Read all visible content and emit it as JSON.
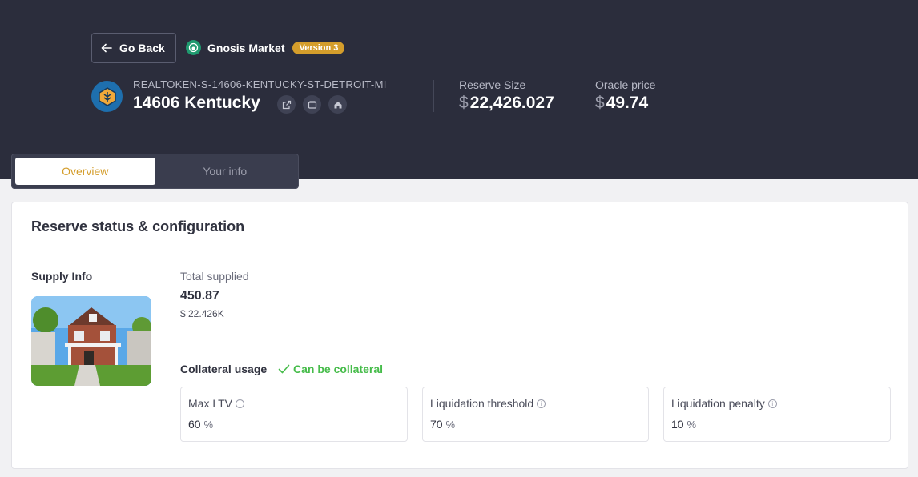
{
  "header": {
    "go_back_label": "Go Back",
    "market_name": "Gnosis Market",
    "market_version": "Version 3"
  },
  "asset": {
    "symbol": "REALTOKEN-S-14606-KENTUCKY-ST-DETROIT-MI",
    "name": "14606 Kentucky",
    "actions": [
      "external-link-icon",
      "wallet-icon",
      "home-icon"
    ]
  },
  "stats": {
    "reserve_size_label": "Reserve Size",
    "reserve_size_currency": "$",
    "reserve_size_value": "22,426.027",
    "oracle_price_label": "Oracle price",
    "oracle_price_currency": "$",
    "oracle_price_value": "49.74"
  },
  "tabs": [
    {
      "label": "Overview",
      "active": true
    },
    {
      "label": "Your info",
      "active": false
    }
  ],
  "reserve": {
    "title": "Reserve status & configuration",
    "supply_info_label": "Supply Info",
    "total_supplied_label": "Total supplied",
    "total_supplied_value": "450.87",
    "total_supplied_usd": "$ 22.426K",
    "collateral_usage_label": "Collateral usage",
    "collateral_status": "Can be collateral",
    "metrics": [
      {
        "label": "Max LTV",
        "value": "60",
        "unit": "%"
      },
      {
        "label": "Liquidation threshold",
        "value": "70",
        "unit": "%"
      },
      {
        "label": "Liquidation penalty",
        "value": "10",
        "unit": "%"
      }
    ]
  },
  "colors": {
    "header_bg": "#2b2d3c",
    "accent": "#d49d2b",
    "success": "#46bc4a"
  }
}
